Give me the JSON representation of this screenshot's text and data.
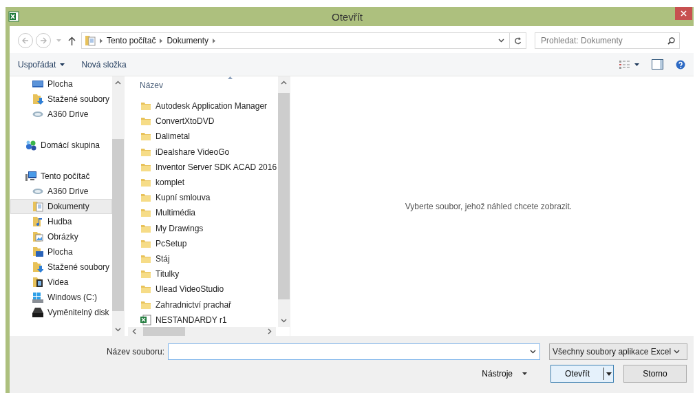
{
  "window": {
    "title": "Otevřít"
  },
  "address": {
    "path": [
      "Tento počítač",
      "Dokumenty"
    ]
  },
  "search": {
    "placeholder": "Prohledat: Dokumenty"
  },
  "toolbar": {
    "buttons": [
      {
        "label": "Uspořádat",
        "kind": "menu"
      },
      {
        "label": "Nová složka",
        "kind": "plain"
      }
    ]
  },
  "nav": {
    "favorites": [
      {
        "label": "Plocha",
        "kind": "desktop",
        "selected": false
      },
      {
        "label": "Stažené soubory",
        "kind": "downloads",
        "selected": false
      },
      {
        "label": "A360 Drive",
        "kind": "cloud",
        "selected": false
      }
    ],
    "items": [
      {
        "label": "Domácí skupina",
        "kind": "homegroup",
        "selected": false
      },
      {
        "label": "Tento počítač",
        "kind": "computer",
        "selected": false,
        "children": [
          {
            "label": "A360 Drive",
            "kind": "cloud",
            "selected": false
          },
          {
            "label": "Dokumenty",
            "kind": "documents",
            "selected": true
          },
          {
            "label": "Hudba",
            "kind": "music",
            "selected": false
          },
          {
            "label": "Obrázky",
            "kind": "pictures",
            "selected": false
          },
          {
            "label": "Plocha",
            "kind": "desktopfolder",
            "selected": false
          },
          {
            "label": "Stažené soubory",
            "kind": "downloads",
            "selected": false
          },
          {
            "label": "Videa",
            "kind": "videos",
            "selected": false
          },
          {
            "label": "Windows (C:)",
            "kind": "drive",
            "selected": false
          },
          {
            "label": "Vyměnitelný disk",
            "kind": "removable",
            "selected": false
          }
        ]
      }
    ]
  },
  "files": {
    "columns": [
      "Název"
    ],
    "rows": [
      {
        "name": "Autodesk Application Manager",
        "kind": "folder"
      },
      {
        "name": "ConvertXtoDVD",
        "kind": "folder"
      },
      {
        "name": "Dalimetal",
        "kind": "folder"
      },
      {
        "name": "iDealshare VideoGo",
        "kind": "folder"
      },
      {
        "name": "Inventor Server SDK ACAD 2016",
        "kind": "folder"
      },
      {
        "name": "komplet",
        "kind": "folder"
      },
      {
        "name": "Kupní smlouva",
        "kind": "folder"
      },
      {
        "name": "Multimédia",
        "kind": "folder"
      },
      {
        "name": "My Drawings",
        "kind": "folder"
      },
      {
        "name": "PcSetup",
        "kind": "folder"
      },
      {
        "name": "Stáj",
        "kind": "folder"
      },
      {
        "name": "Titulky",
        "kind": "folder"
      },
      {
        "name": "Ulead VideoStudio",
        "kind": "folder"
      },
      {
        "name": "Zahradnictví prachař",
        "kind": "folder"
      },
      {
        "name": "NESTANDARDY r1",
        "kind": "excel"
      }
    ]
  },
  "preview": {
    "message": "Vyberte soubor, jehož náhled chcete zobrazit."
  },
  "footer": {
    "filename_label": "Název souboru:",
    "file_type": "Všechny soubory aplikace Excel",
    "tools": "Nástroje",
    "buttons": [
      {
        "label": "Otevřít",
        "kind": "split"
      },
      {
        "label": "Storno",
        "kind": "plain"
      }
    ]
  }
}
